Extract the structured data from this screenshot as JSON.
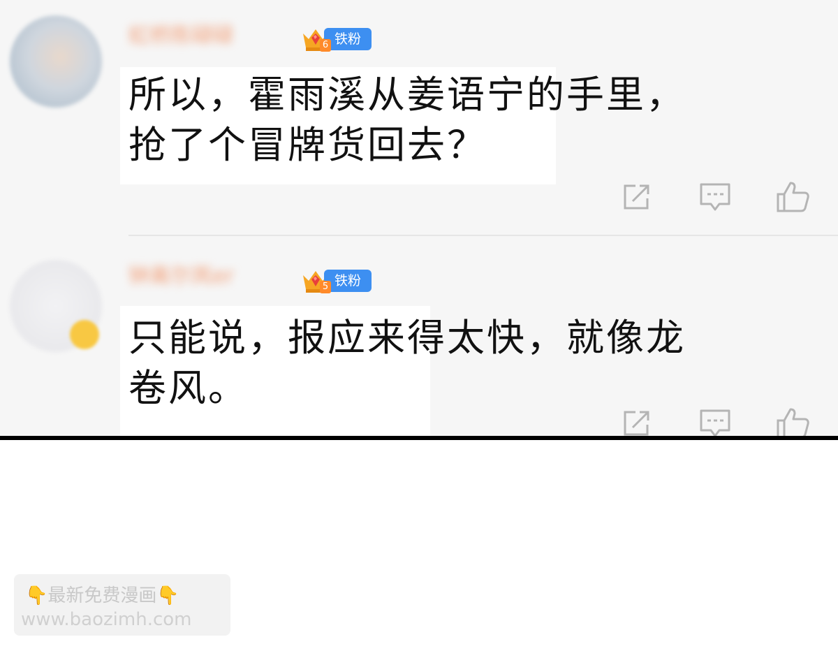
{
  "comments": [
    {
      "username": "虹桥陈碌碌",
      "badge_level": "6",
      "badge_label": "铁粉",
      "text": "所以，霍雨溪从姜语宁的手里，\n抢了个冒牌货回去？"
    },
    {
      "username": "钟离尔岚er",
      "badge_level": "5",
      "badge_label": "铁粉",
      "text": "只能说，报应来得太快，就像龙\n卷风。"
    }
  ],
  "icons": {
    "share": "share-icon",
    "comment": "comment-icon",
    "like": "thumbs-up-icon"
  },
  "watermark": {
    "line1_emoji": "👇",
    "line1_text": "最新免费漫画",
    "line2_text": "www.baozimh.com"
  },
  "colors": {
    "badge_blue": "#3d8ff1",
    "username_blurred": "#f29f78",
    "text": "#111111",
    "icon_gray": "#b4b4b4"
  }
}
